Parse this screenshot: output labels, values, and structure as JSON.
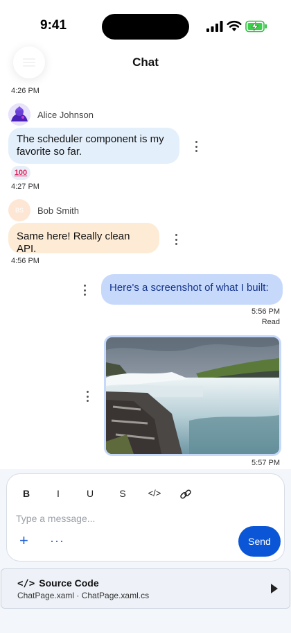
{
  "status_bar": {
    "time": "9:41"
  },
  "header": {
    "title": "Chat"
  },
  "timestamps": {
    "t1": "4:26 PM",
    "t2": "4:27 PM",
    "t3": "4:56 PM"
  },
  "messages": [
    {
      "sender": "Alice Johnson",
      "text": "The scheduler component is my favorite so far.",
      "reaction": "100"
    },
    {
      "sender": "Bob Smith",
      "initials": "BS",
      "text": "Same here! Really clean API."
    },
    {
      "text": "Here's a screenshot of what I built:",
      "time": "5:56 PM",
      "status": "Read"
    },
    {
      "image": "waterfall-photo",
      "time": "5:57 PM"
    }
  ],
  "composer": {
    "format_buttons": [
      "B",
      "I",
      "U",
      "S",
      "</>"
    ],
    "placeholder": "Type a message...",
    "add_label": "+",
    "more_label": "···",
    "send_label": "Send"
  },
  "source_code": {
    "glyph": "</>",
    "title": "Source Code",
    "files": "ChatPage.xaml · ChatPage.xaml.cs"
  },
  "colors": {
    "accent": "#0a56d6",
    "incoming_blue": "#e3effb",
    "incoming_peach": "#fdebd5",
    "outgoing": "#c7d9fb"
  }
}
